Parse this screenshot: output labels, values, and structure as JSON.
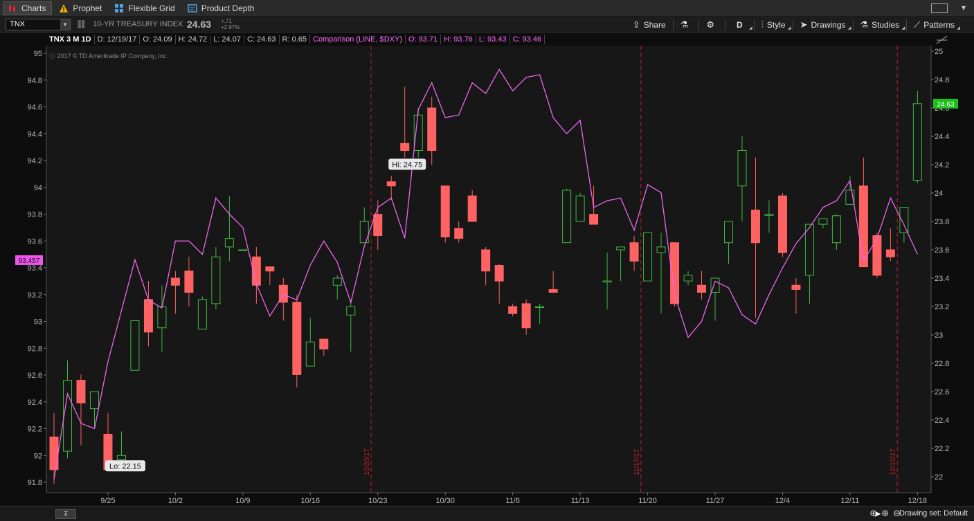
{
  "tabs": [
    {
      "label": "Charts",
      "icon": "candles-icon",
      "active": true
    },
    {
      "label": "Prophet",
      "icon": "warning-icon",
      "active": false
    },
    {
      "label": "Flexible Grid",
      "icon": "grid-icon",
      "active": false
    },
    {
      "label": "Product Depth",
      "icon": "depth-icon",
      "active": false
    }
  ],
  "toolbar": {
    "symbol": "TNX",
    "description": "10-YR TREASURY INDEX",
    "last": "24.63",
    "change_abs": "+.71",
    "change_pct": "+2.97%",
    "share": "Share",
    "period": "D",
    "style": "Style",
    "drawings": "Drawings",
    "studies": "Studies",
    "patterns": "Patterns"
  },
  "info": {
    "name": "TNX 3 M 1D",
    "date": "D: 12/19/17",
    "open": "O: 24.09",
    "high": "H: 24.72",
    "low": "L: 24.07",
    "close": "C: 24.63",
    "range": "R: 0.65",
    "comparison": "Comparison (LINE, $DXY)",
    "c_open": "O: 93.71",
    "c_high": "H: 93.76",
    "c_low": "L: 93.43",
    "c_close": "C: 93.46"
  },
  "copyright": "2017 © TD Ameritrade IP Company, Inc.",
  "colors": {
    "up": "#3fb83f",
    "down": "#ff6262",
    "comparison": "#ee66ee",
    "price_tag": "#19c119",
    "comparison_tag": "#ee55ee"
  },
  "chart_data": {
    "type": "candlestick",
    "left_axis": {
      "min": 91.8,
      "max": 95,
      "ticks": [
        "91.8",
        "92",
        "92.2",
        "92.4",
        "92.6",
        "92.8",
        "93",
        "93.2",
        "93.4",
        "93.6",
        "93.8",
        "94",
        "94.2",
        "94.4",
        "94.6",
        "94.8",
        "95"
      ],
      "current_tag": "93.457"
    },
    "right_axis": {
      "min": 22,
      "max": 25,
      "ticks": [
        "22",
        "22.2",
        "22.4",
        "22.6",
        "22.8",
        "23",
        "23.2",
        "23.4",
        "23.6",
        "23.8",
        "24",
        "24.2",
        "24.4",
        "24.6",
        "24.8",
        "25"
      ],
      "current_tag": "24.63"
    },
    "x_labels": [
      {
        "label": "9/25",
        "index": 4
      },
      {
        "label": "10/2",
        "index": 9
      },
      {
        "label": "10/9",
        "index": 14
      },
      {
        "label": "10/16",
        "index": 19
      },
      {
        "label": "10/23",
        "index": 24
      },
      {
        "label": "10/30",
        "index": 29
      },
      {
        "label": "11/6",
        "index": 34
      },
      {
        "label": "11/13",
        "index": 39
      },
      {
        "label": "11/20",
        "index": 44
      },
      {
        "label": "11/27",
        "index": 49
      },
      {
        "label": "12/4",
        "index": 54
      },
      {
        "label": "12/11",
        "index": 59
      },
      {
        "label": "12/18",
        "index": 64
      }
    ],
    "markers": [
      {
        "label": "10/20/17",
        "after_index": 23
      },
      {
        "label": "11/17/17",
        "after_index": 43
      },
      {
        "label": "12/15/17",
        "after_index": 62
      }
    ],
    "annotations": [
      {
        "label": "Hi: 24.75",
        "index": 25
      },
      {
        "label": "Lo: 22.15",
        "index": 4
      }
    ],
    "candles": [
      [
        22.28,
        22.45,
        21.95,
        22.05
      ],
      [
        22.18,
        22.82,
        22.13,
        22.68
      ],
      [
        22.68,
        22.72,
        22.22,
        22.52
      ],
      [
        22.48,
        22.6,
        22.35,
        22.6
      ],
      [
        22.3,
        22.45,
        22.15,
        22.05
      ],
      [
        22.12,
        22.32,
        22.1,
        22.15
      ],
      [
        22.75,
        23.1,
        22.75,
        23.1
      ],
      [
        23.25,
        23.38,
        22.92,
        23.02
      ],
      [
        23.05,
        23.35,
        22.88,
        23.2
      ],
      [
        23.4,
        23.45,
        23.15,
        23.35
      ],
      [
        23.45,
        23.55,
        23.2,
        23.3
      ],
      [
        23.04,
        23.27,
        23.04,
        23.25
      ],
      [
        23.22,
        23.62,
        23.18,
        23.55
      ],
      [
        23.62,
        23.98,
        23.52,
        23.68
      ],
      [
        23.6,
        23.6,
        23.6,
        23.6
      ],
      [
        23.55,
        23.62,
        23.22,
        23.35
      ],
      [
        23.48,
        23.48,
        23.35,
        23.45
      ],
      [
        23.35,
        23.4,
        23.1,
        23.23
      ],
      [
        23.23,
        23.28,
        22.63,
        22.72
      ],
      [
        22.78,
        23.12,
        22.78,
        22.95
      ],
      [
        22.97,
        22.97,
        22.85,
        22.9
      ],
      [
        23.35,
        23.42,
        23.25,
        23.4
      ],
      [
        23.14,
        23.25,
        22.88,
        23.2
      ],
      [
        23.65,
        23.9,
        23.65,
        23.8
      ],
      [
        23.85,
        23.95,
        23.6,
        23.7
      ],
      [
        24.08,
        24.12,
        23.95,
        24.05
      ],
      [
        24.35,
        24.75,
        24.25,
        24.3
      ],
      [
        24.3,
        24.6,
        24.25,
        24.55
      ],
      [
        24.6,
        24.68,
        24.2,
        24.3
      ],
      [
        24.05,
        24.05,
        23.65,
        23.69
      ],
      [
        23.75,
        23.8,
        23.65,
        23.68
      ],
      [
        23.98,
        24.02,
        23.8,
        23.8
      ],
      [
        23.6,
        23.62,
        23.35,
        23.45
      ],
      [
        23.49,
        23.5,
        23.22,
        23.38
      ],
      [
        23.2,
        23.22,
        23.13,
        23.15
      ],
      [
        23.22,
        23.25,
        23.0,
        23.05
      ],
      [
        23.2,
        23.22,
        23.08,
        23.2
      ],
      [
        23.32,
        23.45,
        23.32,
        23.3
      ],
      [
        23.65,
        24.03,
        23.65,
        24.02
      ],
      [
        23.8,
        24.0,
        23.8,
        23.98
      ],
      [
        23.85,
        24.05,
        23.78,
        23.78
      ],
      [
        23.38,
        23.58,
        23.18,
        23.38
      ],
      [
        23.6,
        23.62,
        23.38,
        23.62
      ],
      [
        23.65,
        23.7,
        23.45,
        23.52
      ],
      [
        23.38,
        23.62,
        23.38,
        23.72
      ],
      [
        23.58,
        23.72,
        23.15,
        23.62
      ],
      [
        23.65,
        23.65,
        23.2,
        23.22
      ],
      [
        23.38,
        23.45,
        23.35,
        23.42
      ],
      [
        23.35,
        23.45,
        23.25,
        23.3
      ],
      [
        23.3,
        23.38,
        23.1,
        23.4
      ],
      [
        23.65,
        23.8,
        23.5,
        23.8
      ],
      [
        24.05,
        24.4,
        23.8,
        24.3
      ],
      [
        23.88,
        24.25,
        23.12,
        23.65
      ],
      [
        23.85,
        23.95,
        23.72,
        23.85
      ],
      [
        23.98,
        24.0,
        23.55,
        23.58
      ],
      [
        23.35,
        23.4,
        23.15,
        23.32
      ],
      [
        23.42,
        23.72,
        23.22,
        23.78
      ],
      [
        23.78,
        23.82,
        23.75,
        23.82
      ],
      [
        23.65,
        23.85,
        23.6,
        23.84
      ],
      [
        23.92,
        24.12,
        23.92,
        24.02
      ],
      [
        24.05,
        24.25,
        23.48,
        23.48
      ],
      [
        23.7,
        23.72,
        23.4,
        23.42
      ],
      [
        23.6,
        23.75,
        23.52,
        23.55
      ],
      [
        23.72,
        23.9,
        23.65,
        23.9
      ],
      [
        24.09,
        24.72,
        24.07,
        24.63
      ]
    ],
    "comparison": {
      "name": "$DXY",
      "values": [
        91.82,
        92.46,
        92.24,
        92.2,
        92.7,
        93.08,
        93.46,
        93.16,
        93.1,
        93.6,
        93.6,
        93.5,
        93.92,
        93.8,
        93.7,
        93.28,
        93.04,
        93.2,
        93.16,
        93.42,
        93.6,
        93.44,
        93.14,
        93.56,
        93.85,
        93.92,
        93.62,
        94.58,
        94.78,
        94.52,
        94.54,
        94.78,
        94.7,
        94.88,
        94.72,
        94.82,
        94.84,
        94.52,
        94.4,
        94.5,
        93.85,
        93.9,
        93.92,
        93.68,
        94.02,
        93.96,
        93.2,
        92.88,
        93.0,
        93.3,
        93.25,
        93.05,
        92.98,
        93.2,
        93.4,
        93.58,
        93.7,
        93.85,
        93.9,
        94.05,
        93.45,
        93.62,
        93.92,
        93.72,
        93.5
      ]
    }
  }
}
